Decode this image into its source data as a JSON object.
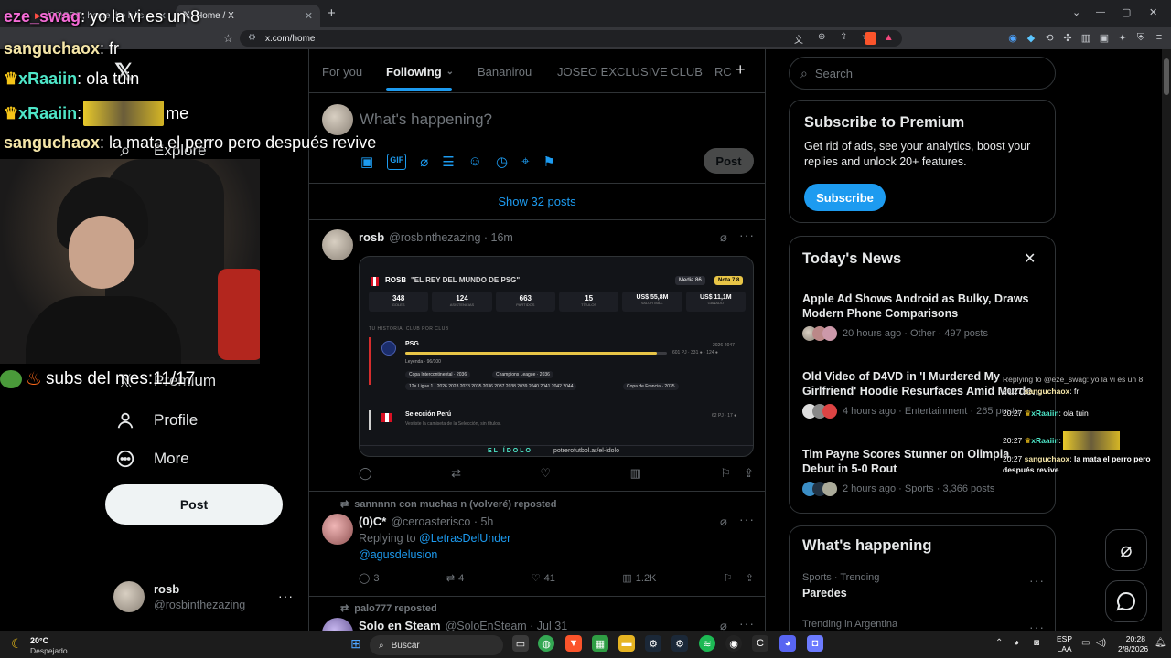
{
  "browser": {
    "tabs": [
      {
        "label": "(28)SEO, home the hills..."
      },
      {
        "label": "Home / X"
      }
    ],
    "url": "x.com/home",
    "new_tab": "+",
    "win_min": "⌄",
    "win_max": "—",
    "win_restore": "▢",
    "win_close": "✕"
  },
  "left_nav": {
    "logo": "𝕏",
    "explore": "Explore",
    "premium": "Premium",
    "profile": "Profile",
    "more": "More",
    "post_button": "Post",
    "account": {
      "name": "rosb",
      "handle": "@rosbinthezazing"
    }
  },
  "timeline": {
    "tabs": [
      "For you",
      "Following",
      "Bananirou",
      "JOSEO EXCLUSIVE CLUB",
      "RC"
    ],
    "active_tab": "Following",
    "composer": {
      "placeholder": "What's happening?",
      "post_button": "Post"
    },
    "show_posts": "Show 32 posts",
    "tweets": [
      {
        "name": "rosb",
        "handle": "@rosbinthezazing · 16m",
        "card": {
          "player": "ROSB",
          "subtitle": "\"EL REY DEL MUNDO DE PSG\"",
          "media": "Media 86",
          "nota": "Nota 7.8",
          "stats": [
            {
              "v": "348",
              "l": "GOLES"
            },
            {
              "v": "124",
              "l": "ASISTENCIAS"
            },
            {
              "v": "663",
              "l": "PARTIDOS"
            },
            {
              "v": "15",
              "l": "TÍTULOS"
            },
            {
              "v": "US$ 55,8M",
              "l": "VALOR MÁX."
            },
            {
              "v": "US$ 11,1M",
              "l": "GANADO"
            }
          ],
          "history_label": "TU HISTORIA, CLUB POR CLUB",
          "club1": "PSG",
          "club1_years": "2026-2047",
          "club1_stats": "601 PJ · 331 ● · 124 ●",
          "club1_legend": "Leyenda · 96/100",
          "trophy1": "Copa Intercontinental · 2036",
          "trophy2": "Champions League · 2036",
          "trophy3": "12× Ligue 1 · 2026 2028 2033 2035 2036 2037 2038 2039 2040 2041 2042 2044",
          "trophy4": "Copa de Francia · 2035",
          "club2": "Selección Perú",
          "club2_stats": "62 PJ · 17 ●",
          "club2_sub": "Vestiste la camiseta de la Selección, sin títulos.",
          "footer_brand": "EL ÍDOLO",
          "footer_url": "potrerofutbol.ar/el-idolo"
        }
      },
      {
        "repost": "sannnnn con muchas n (volveré) reposted",
        "name": "(0)C*",
        "handle": "@ceroasterisco · 5h",
        "replying": "Replying to",
        "reply_to": "@LetrasDelUnder",
        "mention": "@agusdelusion",
        "replies": "3",
        "reposts": "4",
        "likes": "41",
        "views": "1.2K"
      },
      {
        "repost": "palo777 reposted",
        "name": "Solo en Steam",
        "handle": "@SoloEnSteam · Jul 31"
      }
    ]
  },
  "sidebar": {
    "search_placeholder": "Search",
    "premium": {
      "title": "Subscribe to Premium",
      "body": "Get rid of ads, see your analytics, boost your replies and unlock 20+ features.",
      "button": "Subscribe"
    },
    "news": {
      "title": "Today's News",
      "items": [
        {
          "title": "Apple Ad Shows Android as Bulky, Draws Modern Phone Comparisons",
          "meta": "20 hours ago · Other · 497 posts"
        },
        {
          "title": "Old Video of D4VD in 'I Murdered My Girlfriend' Hoodie Resurfaces Amid Murde...",
          "meta": "4 hours ago · Entertainment · 265 posts"
        },
        {
          "title": "Tim Payne Scores Stunner on Olimpia Debut in 5-0 Rout",
          "meta": "2 hours ago · Sports · 3,366 posts"
        }
      ]
    },
    "happening": {
      "title": "What's happening",
      "items": [
        {
          "context": "Sports · Trending",
          "topic": "Paredes"
        },
        {
          "context": "Trending in Argentina",
          "topic": ""
        }
      ]
    }
  },
  "overlay": {
    "chat": [
      {
        "user": "eze_swag",
        "msg": "yo la vi es un 8"
      },
      {
        "user": "sanguchaox",
        "msg": "fr"
      },
      {
        "user": "xRaaiin",
        "msg": "ola tuin"
      },
      {
        "user": "xRaaiin",
        "msg": "me"
      },
      {
        "user": "sanguchaox",
        "msg": "la mata el perro pero después revive"
      }
    ],
    "subs": "subs del mes:11/17",
    "mini_chat": [
      {
        "text": "Replying to @eze_swag: yo la vi es un 8"
      },
      {
        "time": "20:27",
        "user": "sanguchaox",
        "msg": "fr"
      },
      {
        "time": "20:27",
        "user": "xRaaiin",
        "msg": "ola tuin"
      },
      {
        "time": "20:27",
        "user": "xRaaiin",
        "msg": ""
      },
      {
        "time": "20:27",
        "user": "sanguchaox",
        "msg": "la mata el perro pero después revive"
      }
    ]
  },
  "taskbar": {
    "weather_temp": "20°C",
    "weather_desc": "Despejado",
    "search": "Buscar",
    "lang": "ESP",
    "lang2": "LAA",
    "time": "20:28",
    "date": "2/8/2026"
  }
}
